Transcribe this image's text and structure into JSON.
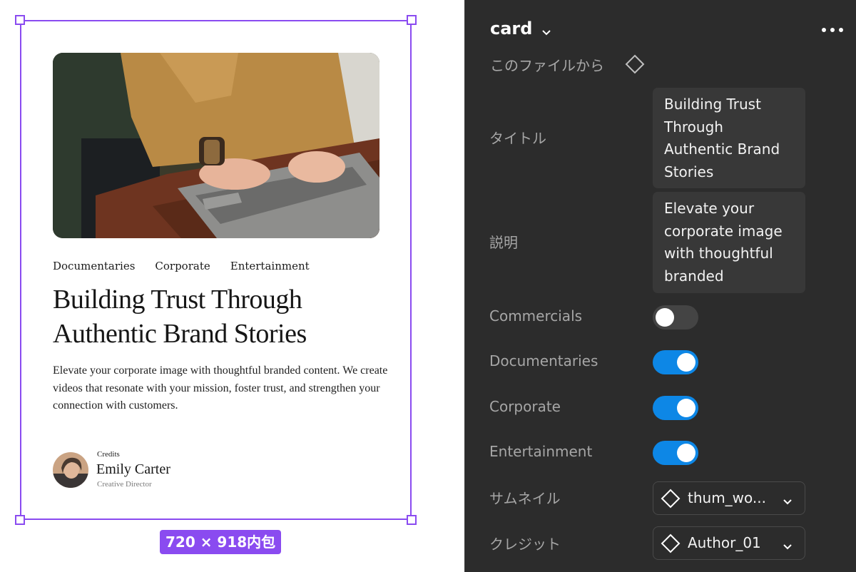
{
  "canvas": {
    "size_label": "720 × 918内包",
    "card": {
      "tags": [
        "Documentaries",
        "Corporate",
        "Entertainment"
      ],
      "title": "Building Trust Through Authentic Brand Stories",
      "description": "Elevate your corporate image with thoughtful branded content. We create videos that resonate with your mission, foster trust, and strengthen your connection with customers.",
      "credits_label": "Credits",
      "author_name": "Emily Carter",
      "author_role": "Creative Director"
    }
  },
  "panel": {
    "component_name": "card",
    "source_label": "このファイルから",
    "title_label": "タイトル",
    "title_value": "Building Trust Through Authentic Brand Stories",
    "description_label": "説明",
    "description_value": "Elevate your corporate image with thoughtful branded",
    "toggles": [
      {
        "label": "Commercials",
        "on": false
      },
      {
        "label": "Documentaries",
        "on": true
      },
      {
        "label": "Corporate",
        "on": true
      },
      {
        "label": "Entertainment",
        "on": true
      }
    ],
    "thumbnail_label": "サムネイル",
    "thumbnail_value": "thum_wo...",
    "credit_label": "クレジット",
    "credit_value": "Author_01"
  },
  "colors": {
    "selection": "#8a4bf0",
    "toggle_on": "#0d87e6",
    "panel_bg": "#2c2c2c"
  },
  "icons": [
    "component-diamond-icon",
    "chevron-down-icon",
    "more-dots-icon"
  ]
}
